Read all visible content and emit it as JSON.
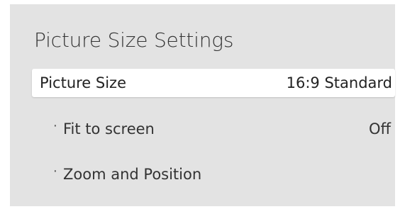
{
  "menu": {
    "title": "Picture Size Settings",
    "items": [
      {
        "label": "Picture Size",
        "value": "16:9 Standard",
        "selected": true
      },
      {
        "label": "Fit to screen",
        "value": "Off",
        "bullet": "·"
      },
      {
        "label": "Zoom and Position",
        "value": "",
        "bullet": "·"
      }
    ]
  },
  "colors": {
    "panel_background": "#e3e3e3",
    "selected_row_background": "#ffffff",
    "text": "#333333"
  }
}
